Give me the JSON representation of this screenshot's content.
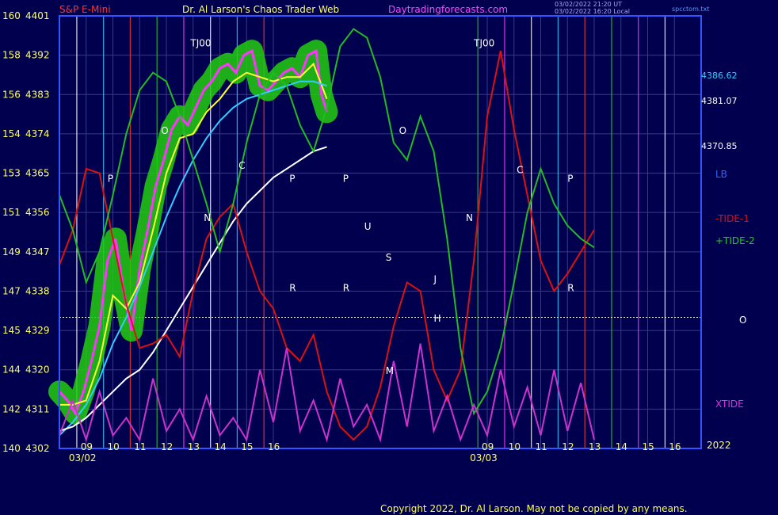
{
  "header": {
    "symbol": "S&P E-Mini",
    "title": "Dr. Al Larson's Chaos Trader Web",
    "site": "Daytradingforecasts.com",
    "stamp1": "03/02/2022 21:20 UT",
    "stamp2": "03/02/2022 16:20 Local",
    "file": "spcctom.txt"
  },
  "footer": {
    "copyright": "Copyright 2022, Dr. Al Larson. May not be copied by any means."
  },
  "right_labels": {
    "v1": "4386.62",
    "v2": "4381.07",
    "v3": "4370.85",
    "lb": "LB",
    "tide1": "-TIDE-1",
    "tide2": "+TIDE-2",
    "o": "O",
    "xtide": "XTIDE",
    "year": "2022"
  },
  "colors": {
    "background": "#00004e",
    "grid": "#38388a",
    "price_fill": "#22cc11",
    "price_line": "#ff33ff",
    "ma_short": "#ffff33",
    "ma_mid": "#33ccff",
    "ma_long": "#ffffff",
    "tide1": "#dd1111",
    "tide2": "#22bb22",
    "xtide": "#cc33cc",
    "frame": "#3355ff"
  },
  "chart_data": {
    "type": "line",
    "title": "S&P E-Mini",
    "y_left_ticks": [
      "140",
      "142",
      "144",
      "145",
      "147",
      "149",
      "151",
      "153",
      "154",
      "156",
      "158",
      "160"
    ],
    "y_price_ticks": [
      4302,
      4311,
      4320,
      4329,
      4338,
      4347,
      4356,
      4365,
      4374,
      4383,
      4392,
      4401
    ],
    "ylim": [
      4302,
      4401
    ],
    "x_ticks": [
      "09",
      "10",
      "11",
      "12",
      "13",
      "14",
      "15",
      "16",
      "09",
      "10",
      "11",
      "12",
      "13",
      "14",
      "15",
      "16"
    ],
    "x_tick_times": [
      9,
      10,
      11,
      12,
      13,
      14,
      15,
      16,
      24,
      25,
      26,
      27,
      28,
      29,
      30,
      31
    ],
    "date_labels": [
      {
        "text": "03/02",
        "at": 8.5
      },
      {
        "text": "03/03",
        "at": 23.5
      }
    ],
    "xlim": [
      8,
      32
    ],
    "markers": [
      {
        "text": "P",
        "x": 9.8,
        "y": 4363
      },
      {
        "text": "O",
        "x": 11.8,
        "y": 4374
      },
      {
        "text": "TJ00",
        "x": 12.9,
        "y": 4394
      },
      {
        "text": "N",
        "x": 13.4,
        "y": 4354
      },
      {
        "text": "C",
        "x": 14.7,
        "y": 4366
      },
      {
        "text": "P",
        "x": 16.6,
        "y": 4363
      },
      {
        "text": "R",
        "x": 16.6,
        "y": 4338
      },
      {
        "text": "P",
        "x": 18.6,
        "y": 4363
      },
      {
        "text": "R",
        "x": 18.6,
        "y": 4338
      },
      {
        "text": "U",
        "x": 19.4,
        "y": 4352
      },
      {
        "text": "S",
        "x": 20.2,
        "y": 4345
      },
      {
        "text": "M",
        "x": 20.2,
        "y": 4319
      },
      {
        "text": "O",
        "x": 20.7,
        "y": 4374
      },
      {
        "text": "TJ00",
        "x": 23.5,
        "y": 4394
      },
      {
        "text": "N",
        "x": 23.2,
        "y": 4354
      },
      {
        "text": "J",
        "x": 22.0,
        "y": 4340
      },
      {
        "text": "H",
        "x": 22.0,
        "y": 4331
      },
      {
        "text": "C",
        "x": 25.1,
        "y": 4365
      },
      {
        "text": "P",
        "x": 27.0,
        "y": 4363
      },
      {
        "text": "R",
        "x": 27.0,
        "y": 4338
      }
    ],
    "series": [
      {
        "name": "S&P E-Mini",
        "color": "#ff33ff",
        "x": [
          8.0,
          8.3,
          8.6,
          8.9,
          9.2,
          9.5,
          9.8,
          10.1,
          10.4,
          10.7,
          11.0,
          11.3,
          11.6,
          11.9,
          12.2,
          12.5,
          12.8,
          13.1,
          13.4,
          13.7,
          14.0,
          14.3,
          14.6,
          14.9,
          15.2,
          15.5,
          15.8,
          16.1,
          16.4,
          16.7,
          17.0,
          17.3,
          17.6,
          17.8,
          18.0
        ],
        "y": [
          4315,
          4313,
          4310,
          4315,
          4322,
          4330,
          4345,
          4350,
          4338,
          4329,
          4343,
          4352,
          4362,
          4368,
          4375,
          4378,
          4376,
          4380,
          4384,
          4386,
          4389,
          4390,
          4388,
          4392,
          4393,
          4385,
          4384,
          4386,
          4388,
          4389,
          4387,
          4392,
          4393,
          4383,
          4379
        ]
      },
      {
        "name": "MA short",
        "color": "#ffff33",
        "x": [
          8.0,
          8.5,
          9.0,
          9.5,
          10.0,
          10.5,
          11.0,
          11.5,
          12.0,
          12.5,
          13.0,
          13.5,
          14.0,
          14.5,
          15.0,
          15.5,
          16.0,
          16.5,
          17.0,
          17.5,
          18.0
        ],
        "y": [
          4312,
          4312,
          4313,
          4322,
          4337,
          4334,
          4340,
          4352,
          4365,
          4373,
          4374,
          4379,
          4382,
          4386,
          4388,
          4387,
          4386,
          4387,
          4387,
          4390,
          4382
        ]
      },
      {
        "name": "MA mid",
        "color": "#33ccff",
        "x": [
          8.0,
          8.5,
          9.0,
          9.5,
          10.0,
          10.5,
          11.0,
          11.5,
          12.0,
          12.5,
          13.0,
          13.5,
          14.0,
          14.5,
          15.0,
          15.5,
          16.0,
          16.5,
          17.0,
          17.5,
          18.0
        ],
        "y": [
          4305,
          4308,
          4312,
          4318,
          4326,
          4332,
          4339,
          4347,
          4355,
          4362,
          4368,
          4373,
          4377,
          4380,
          4382,
          4383,
          4384,
          4385,
          4386,
          4386,
          4385
        ]
      },
      {
        "name": "MA long",
        "color": "#ffffff",
        "x": [
          8.0,
          8.5,
          9.0,
          9.5,
          10.0,
          10.5,
          11.0,
          11.5,
          12.0,
          12.5,
          13.0,
          13.5,
          14.0,
          14.5,
          15.0,
          15.5,
          16.0,
          16.5,
          17.0,
          17.5,
          18.0
        ],
        "y": [
          4306,
          4307,
          4309,
          4312,
          4315,
          4318,
          4320,
          4324,
          4329,
          4334,
          4339,
          4344,
          4349,
          4354,
          4358,
          4361,
          4364,
          4366,
          4368,
          4370,
          4371
        ]
      },
      {
        "name": "TIDE-1",
        "color": "#dd1111",
        "x": [
          8.0,
          8.5,
          9.0,
          9.5,
          10.0,
          10.5,
          11.0,
          11.5,
          12.0,
          12.5,
          13.0,
          13.5,
          14.0,
          14.5,
          15.0,
          15.5,
          16.0,
          16.5,
          17.0,
          17.5,
          18.0,
          18.5,
          19.0,
          19.5,
          20.0,
          20.5,
          21.0,
          21.5,
          22.0,
          22.5,
          23.0,
          23.5,
          24.0,
          24.5,
          25.0,
          25.5,
          26.0,
          26.5,
          27.0,
          27.5,
          28.0
        ],
        "y": [
          4344,
          4352,
          4366,
          4365,
          4350,
          4335,
          4325,
          4326,
          4328,
          4323,
          4338,
          4350,
          4355,
          4358,
          4347,
          4338,
          4334,
          4325,
          4322,
          4328,
          4315,
          4307,
          4304,
          4307,
          4316,
          4330,
          4340,
          4338,
          4320,
          4313,
          4320,
          4345,
          4378,
          4393,
          4375,
          4360,
          4345,
          4338,
          4342,
          4347,
          4352
        ]
      },
      {
        "name": "TIDE-2",
        "color": "#22bb22",
        "x": [
          8.0,
          8.5,
          9.0,
          9.5,
          10.0,
          10.5,
          11.0,
          11.5,
          12.0,
          12.5,
          13.0,
          13.5,
          14.0,
          14.5,
          15.0,
          15.5,
          16.0,
          16.5,
          17.0,
          17.5,
          18.0,
          18.5,
          19.0,
          19.5,
          20.0,
          20.5,
          21.0,
          21.5,
          22.0,
          22.5,
          23.0,
          23.5,
          24.0,
          24.5,
          25.0,
          25.5,
          26.0,
          26.5,
          27.0,
          27.5,
          28.0
        ],
        "y": [
          4360,
          4352,
          4340,
          4347,
          4360,
          4374,
          4384,
          4388,
          4386,
          4378,
          4368,
          4358,
          4347,
          4358,
          4372,
          4383,
          4388,
          4385,
          4376,
          4370,
          4380,
          4394,
          4398,
          4396,
          4387,
          4372,
          4368,
          4378,
          4370,
          4350,
          4325,
          4310,
          4315,
          4325,
          4340,
          4356,
          4366,
          4358,
          4353,
          4350,
          4348
        ]
      },
      {
        "name": "XTIDE",
        "color": "#cc33cc",
        "x": [
          8.0,
          8.5,
          9.0,
          9.5,
          10.0,
          10.5,
          11.0,
          11.5,
          12.0,
          12.5,
          13.0,
          13.5,
          14.0,
          14.5,
          15.0,
          15.5,
          16.0,
          16.5,
          17.0,
          17.5,
          18.0,
          18.5,
          19.0,
          19.5,
          20.0,
          20.5,
          21.0,
          21.5,
          22.0,
          22.5,
          23.0,
          23.5,
          24.0,
          24.5,
          25.0,
          25.5,
          26.0,
          26.5,
          27.0,
          27.5,
          28.0
        ],
        "y": [
          4305,
          4313,
          4304,
          4315,
          4305,
          4309,
          4304,
          4318,
          4306,
          4311,
          4304,
          4314,
          4305,
          4309,
          4304,
          4320,
          4308,
          4325,
          4306,
          4313,
          4304,
          4318,
          4307,
          4312,
          4304,
          4322,
          4307,
          4326,
          4306,
          4314,
          4304,
          4312,
          4305,
          4320,
          4307,
          4316,
          4305,
          4320,
          4306,
          4317,
          4304
        ]
      }
    ]
  }
}
